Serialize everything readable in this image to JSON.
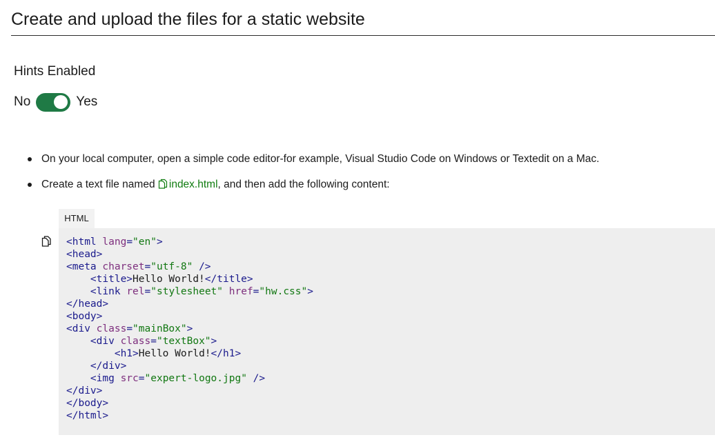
{
  "header": {
    "title": "Create and upload the files for a static website"
  },
  "hints": {
    "label": "Hints Enabled",
    "off_label": "No",
    "on_label": "Yes",
    "enabled": true
  },
  "steps": [
    {
      "text": "On your local computer, open a simple code editor-for example, Visual Studio Code on Windows or Textedit on a Mac."
    },
    {
      "prefix": "Create a text file named ",
      "link": "index.html",
      "suffix": ", and then add the following content:"
    }
  ],
  "code": {
    "language": "HTML",
    "lines": [
      [
        [
          "t",
          "<html "
        ],
        [
          "a",
          "lang"
        ],
        [
          "t",
          "="
        ],
        [
          "v",
          "\"en\""
        ],
        [
          "t",
          ">"
        ]
      ],
      [
        [
          "t",
          "<head>"
        ]
      ],
      [
        [
          "t",
          "<meta "
        ],
        [
          "a",
          "charset"
        ],
        [
          "t",
          "="
        ],
        [
          "v",
          "\"utf-8\""
        ],
        [
          "t",
          " />"
        ]
      ],
      [
        [
          "x",
          "    "
        ],
        [
          "t",
          "<title>"
        ],
        [
          "x",
          "Hello World!"
        ],
        [
          "t",
          "</title>"
        ]
      ],
      [
        [
          "x",
          "    "
        ],
        [
          "t",
          "<link "
        ],
        [
          "a",
          "rel"
        ],
        [
          "t",
          "="
        ],
        [
          "v",
          "\"stylesheet\""
        ],
        [
          "x",
          " "
        ],
        [
          "a",
          "href"
        ],
        [
          "t",
          "="
        ],
        [
          "v",
          "\"hw.css\""
        ],
        [
          "t",
          ">"
        ]
      ],
      [
        [
          "t",
          "</head>"
        ]
      ],
      [
        [
          "t",
          "<body>"
        ]
      ],
      [
        [
          "t",
          "<div "
        ],
        [
          "a",
          "class"
        ],
        [
          "t",
          "="
        ],
        [
          "v",
          "\"mainBox\""
        ],
        [
          "t",
          ">"
        ]
      ],
      [
        [
          "x",
          "    "
        ],
        [
          "t",
          "<div "
        ],
        [
          "a",
          "class"
        ],
        [
          "t",
          "="
        ],
        [
          "v",
          "\"textBox\""
        ],
        [
          "t",
          ">"
        ]
      ],
      [
        [
          "x",
          "        "
        ],
        [
          "t",
          "<h1>"
        ],
        [
          "x",
          "Hello World!"
        ],
        [
          "t",
          "</h1>"
        ]
      ],
      [
        [
          "x",
          "    "
        ],
        [
          "t",
          "</div>"
        ]
      ],
      [
        [
          "x",
          "    "
        ],
        [
          "t",
          "<img "
        ],
        [
          "a",
          "src"
        ],
        [
          "t",
          "="
        ],
        [
          "v",
          "\"expert-logo.jpg\""
        ],
        [
          "t",
          " />"
        ]
      ],
      [
        [
          "t",
          "</div>"
        ]
      ],
      [
        [
          "t",
          "</body>"
        ]
      ],
      [
        [
          "t",
          "</html>"
        ]
      ]
    ]
  },
  "icons": {
    "copy": "copy-icon",
    "toggle_color": "#1f7a45",
    "link_color": "#107c10",
    "tag_color": "#1a1a8c",
    "attr_color": "#7d2e7d",
    "value_color": "#117711"
  }
}
